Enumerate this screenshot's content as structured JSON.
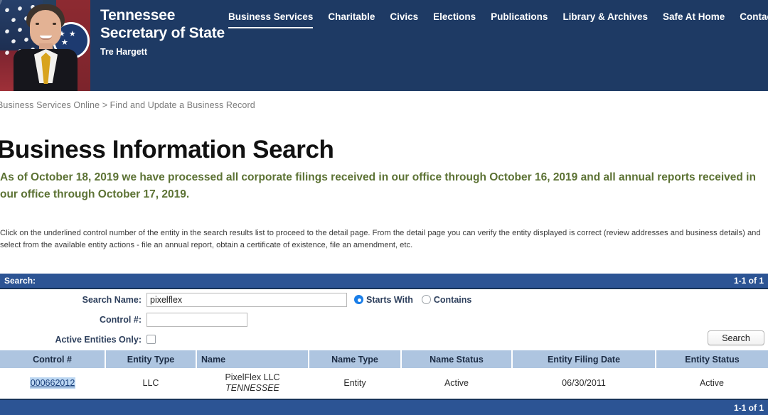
{
  "header": {
    "brand_title": "Tennessee Secretary of State",
    "brand_subtitle": "Tre Hargett",
    "portrait_alt": "tre-hargett-portrait",
    "nav": [
      {
        "label": "Business Services",
        "active": true
      },
      {
        "label": "Charitable",
        "active": false
      },
      {
        "label": "Civics",
        "active": false
      },
      {
        "label": "Elections",
        "active": false
      },
      {
        "label": "Publications",
        "active": false
      },
      {
        "label": "Library & Archives",
        "active": false
      },
      {
        "label": "Safe At Home",
        "active": false
      },
      {
        "label": "Contact Us",
        "active": false
      }
    ]
  },
  "breadcrumb": "Business Services Online > Find and Update a Business Record",
  "page_title": "Business Information Search",
  "notice": "As of October 18, 2019 we have processed all corporate filings received in our office through October 16, 2019 and all annual reports received in our office through October 17, 2019.",
  "instructions": "Click on the underlined control number of the entity in the search results list to proceed to the detail page. From the detail page you can verify the entity displayed is correct (review addresses and business details) and select from the available entity actions - file an annual report, obtain a certificate of existence, file an amendment, etc.",
  "search_panel": {
    "title": "Search:",
    "result_count": "1-1 of 1",
    "labels": {
      "search_name": "Search Name:",
      "control_number": "Control #:",
      "active_entities_only": "Active Entities Only:"
    },
    "values": {
      "search_name": "pixelflex",
      "control_number": ""
    },
    "placeholders": {
      "search_name": "",
      "control_number": ""
    },
    "match_options": [
      {
        "label": "Starts With",
        "selected": true
      },
      {
        "label": "Contains",
        "selected": false
      }
    ],
    "active_entities_checked": false,
    "search_button": "Search"
  },
  "results": {
    "columns": [
      "Control #",
      "Entity Type",
      "Name",
      "Name Type",
      "Name Status",
      "Entity Filing Date",
      "Entity Status"
    ],
    "rows": [
      {
        "control_number": "000662012",
        "entity_type": "LLC",
        "name": "PixelFlex LLC",
        "jurisdiction": "TENNESSEE",
        "name_type": "Entity",
        "name_status": "Active",
        "entity_filing_date": "06/30/2011",
        "entity_status": "Active"
      }
    ]
  },
  "footer": {
    "result_count": "1-1 of 1"
  },
  "colors": {
    "header_navy": "#1e3a64",
    "bar_blue": "#2c5494",
    "table_header_blue": "#aec5e0",
    "notice_green": "#5c7234",
    "link_blue": "#1a3f7a",
    "radio_accent": "#1a7ee8",
    "selection_highlight": "#bcd7f2"
  }
}
